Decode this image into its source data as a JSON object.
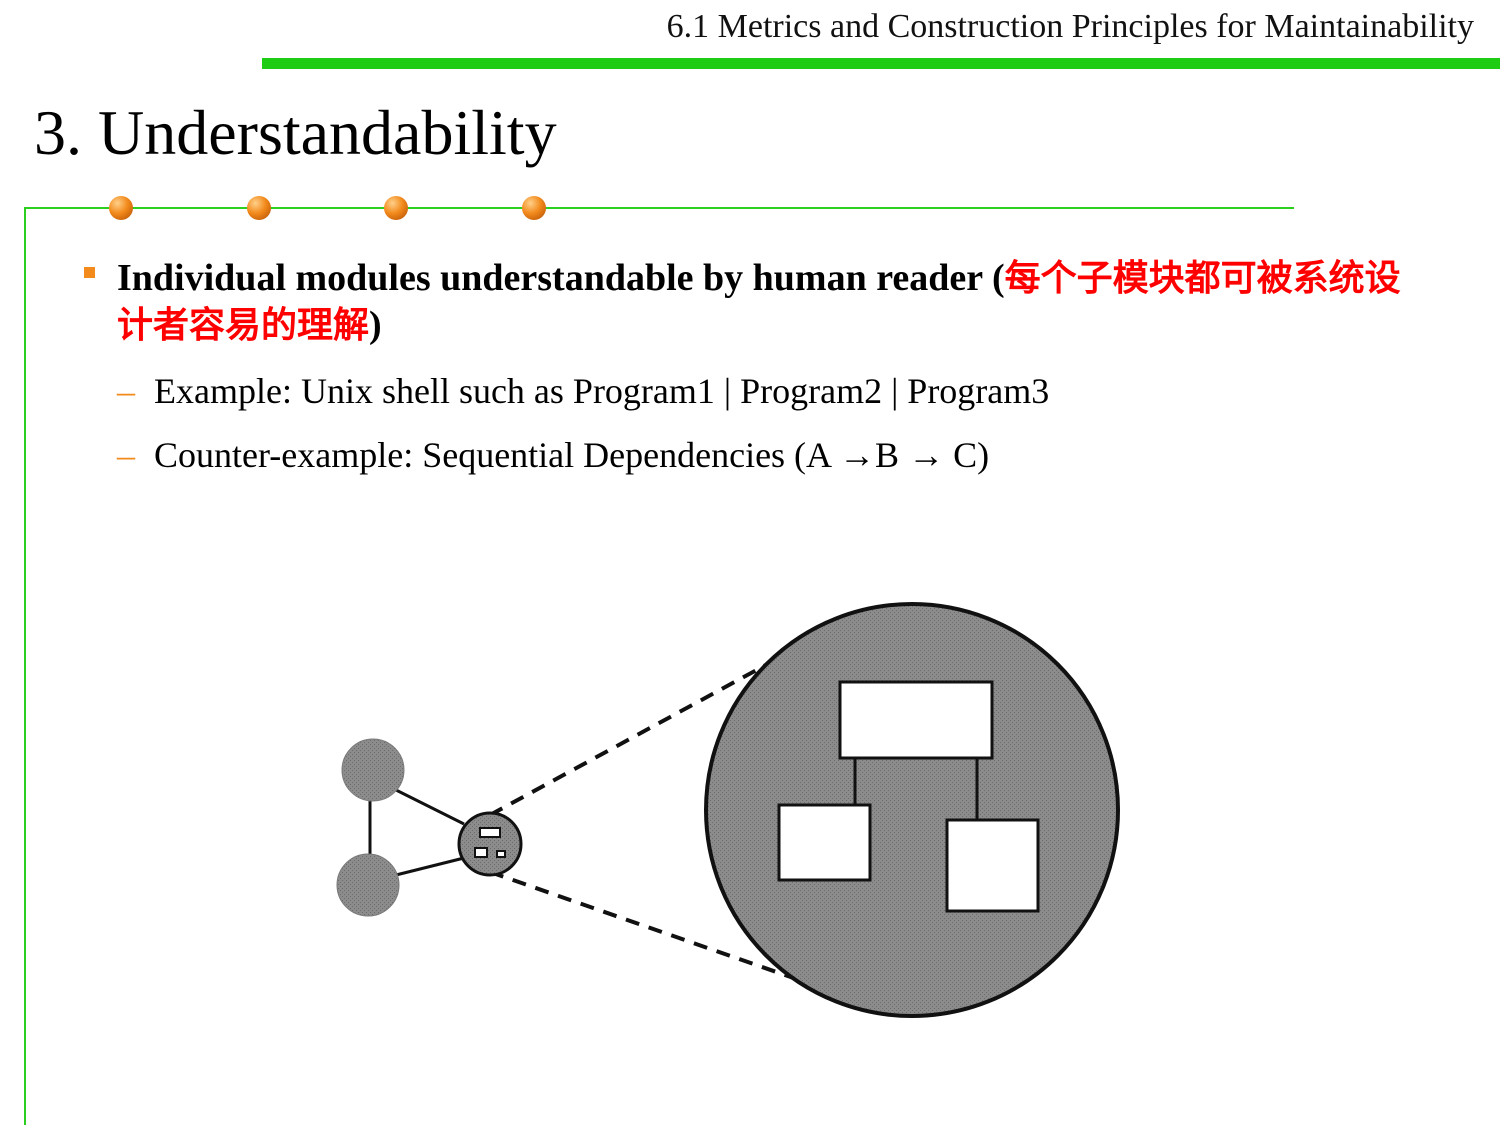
{
  "header": {
    "section_title": "6.1 Metrics and Construction Principles for Maintainability"
  },
  "slide": {
    "title": "3. Understandability"
  },
  "bullet": {
    "main_en": "Individual modules understandable by human reader (",
    "main_cn": "每个子模块都可被系统设计者容易的理解",
    "main_close": ")",
    "subitems": [
      {
        "dash": "–",
        "text": "Example: Unix shell such as Program1 | Program2 | Program3"
      },
      {
        "dash": "–",
        "text": "Counter-example: Sequential Dependencies (A →B → C)"
      }
    ]
  },
  "colors": {
    "accent_green": "#1ecc14",
    "bullet_orange": "#f28a1c",
    "highlight_red": "#ff0000"
  },
  "icons": [
    "orange-ball-icon",
    "square-bullet-icon"
  ]
}
